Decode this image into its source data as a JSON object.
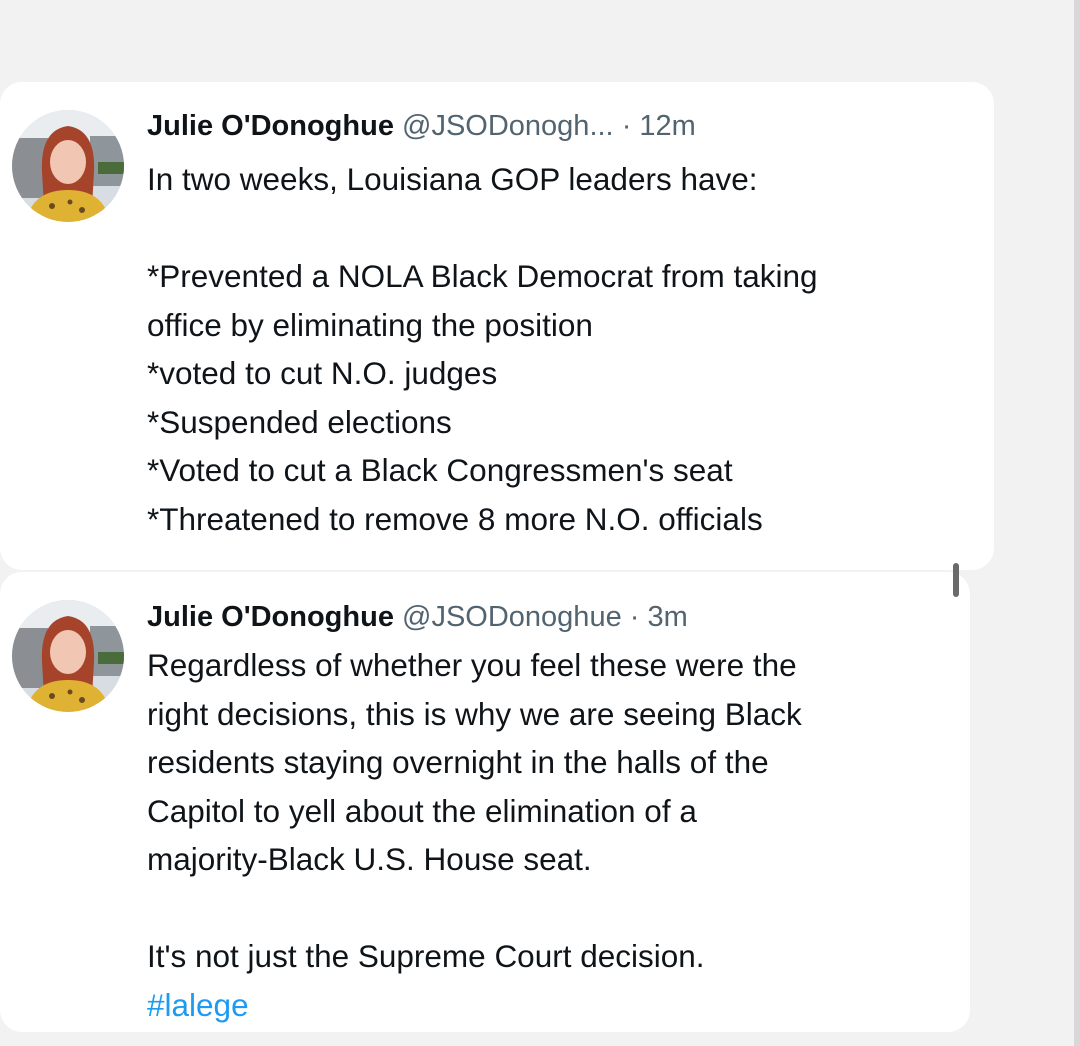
{
  "tweets": [
    {
      "author_name": "Julie O'Donoghue",
      "handle": "@JSODonogh...",
      "separator": "·",
      "time": "12m",
      "lines": [
        "In two weeks, Louisiana GOP leaders have:",
        "",
        "*Prevented a NOLA Black Democrat from taking",
        "office by eliminating the position",
        "*voted to cut N.O. judges",
        "*Suspended elections",
        "*Voted to cut a Black Congressmen's seat",
        "*Threatened to remove 8 more N.O. officials"
      ]
    },
    {
      "author_name": "Julie O'Donoghue",
      "handle": "@JSODonoghue",
      "separator": "·",
      "time": "3m",
      "lines": [
        "Regardless of whether you feel these were the",
        "right decisions, this is why we are seeing Black",
        "residents staying overnight in the halls of the",
        "Capitol to yell about the elimination of a",
        "majority-Black U.S. House seat.",
        "",
        "It's not just the Supreme Court decision."
      ],
      "hashtag": "#lalege"
    }
  ],
  "colors": {
    "text": "#0f1419",
    "secondary": "#536471",
    "link": "#1d9bf0",
    "background": "#f2f2f3",
    "card": "#ffffff"
  },
  "icons": {
    "avatar": "profile-photo-avatar"
  }
}
